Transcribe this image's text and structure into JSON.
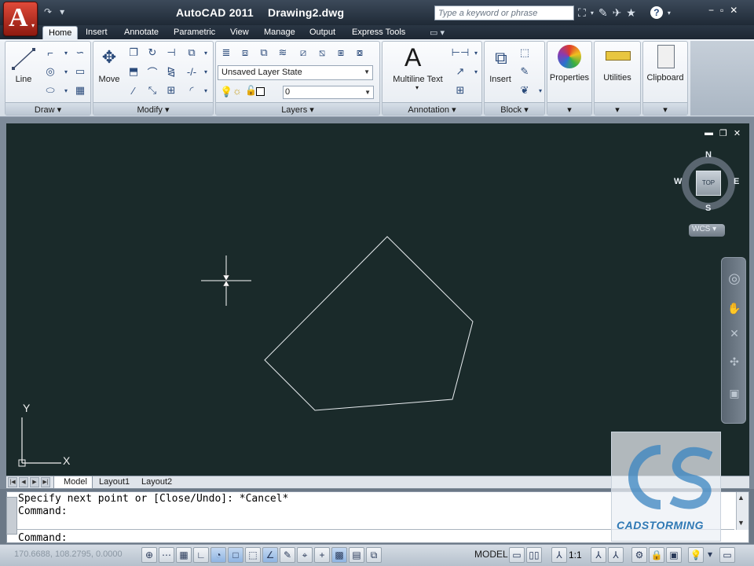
{
  "app": {
    "name": "AutoCAD 2011",
    "document": "Drawing2.dwg",
    "logo_letter": "A"
  },
  "search": {
    "placeholder": "Type a keyword or phrase"
  },
  "tabs": [
    {
      "label": "Home"
    },
    {
      "label": "Insert"
    },
    {
      "label": "Annotate"
    },
    {
      "label": "Parametric"
    },
    {
      "label": "View"
    },
    {
      "label": "Manage"
    },
    {
      "label": "Output"
    },
    {
      "label": "Express Tools"
    }
  ],
  "ribbon": {
    "draw": {
      "title": "Draw",
      "line_label": "Line"
    },
    "modify": {
      "title": "Modify",
      "move_label": "Move"
    },
    "layers": {
      "title": "Layers",
      "layer_state": "Unsaved Layer State",
      "current_layer": "0"
    },
    "annotation": {
      "title": "Annotation",
      "mtext_label": "Multiline Text"
    },
    "block": {
      "title": "Block",
      "insert_label": "Insert"
    },
    "properties": {
      "label": "Properties"
    },
    "utilities": {
      "label": "Utilities"
    },
    "clipboard": {
      "label": "Clipboard"
    }
  },
  "viewcube": {
    "north": "N",
    "south": "S",
    "east": "E",
    "west": "W",
    "face": "TOP",
    "wcs": "WCS"
  },
  "ucs": {
    "x": "X",
    "y": "Y"
  },
  "layout_tabs": [
    {
      "label": "Model"
    },
    {
      "label": "Layout1"
    },
    {
      "label": "Layout2"
    }
  ],
  "command": {
    "line1": "Specify next point or [Close/Undo]: *Cancel*",
    "line2": "Command:",
    "prompt": "Command:"
  },
  "status": {
    "coordinates": "170.6688, 108.2795, 0.0000",
    "space": "MODEL",
    "scale": "1:1"
  },
  "watermark": {
    "text": "CADSTORMING"
  },
  "colors": {
    "viewport_bg": "#1a2a2a",
    "accent": "#d23a2a"
  }
}
